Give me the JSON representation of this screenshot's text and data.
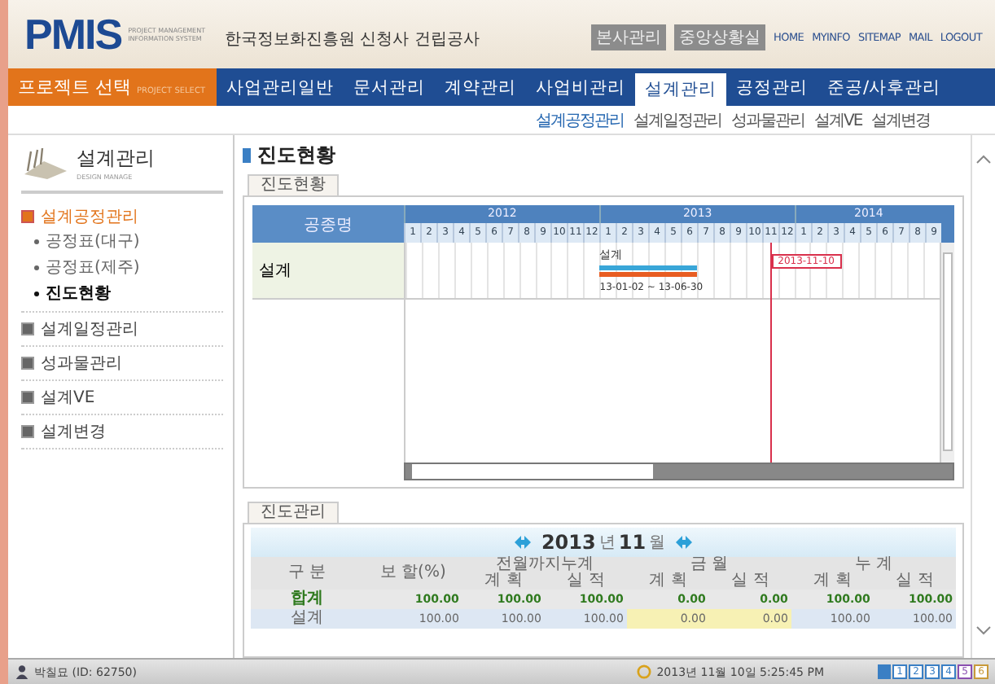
{
  "header": {
    "logo": "PMIS",
    "logo_sub": [
      "PROJECT MANAGEMENT",
      "INFORMATION SYSTEM"
    ],
    "project": "한국정보화진흥원 신청사 건립공사",
    "buttons": [
      "본사관리",
      "중앙상황실"
    ],
    "links": [
      "HOME",
      "MYINFO",
      "SITEMAP",
      "MAIL",
      "LOGOUT"
    ]
  },
  "project_select": {
    "label": "프로젝트 선택",
    "sub": "PROJECT SELECT"
  },
  "nav": [
    {
      "label": "사업관리일반",
      "selected": false
    },
    {
      "label": "문서관리",
      "selected": false
    },
    {
      "label": "계약관리",
      "selected": false
    },
    {
      "label": "사업비관리",
      "selected": false
    },
    {
      "label": "설계관리",
      "selected": true
    },
    {
      "label": "공정관리",
      "selected": false
    },
    {
      "label": "준공/사후관리",
      "selected": false
    }
  ],
  "subnav": [
    {
      "label": "설계공정관리",
      "selected": true
    },
    {
      "label": "설계일정관리",
      "selected": false
    },
    {
      "label": "성과물관리",
      "selected": false
    },
    {
      "label": "설계VE",
      "selected": false
    },
    {
      "label": "설계변경",
      "selected": false
    }
  ],
  "sidebar": {
    "title": "설계관리",
    "subtitle": "DESIGN MANAGE",
    "items": [
      {
        "label": "설계공정관리",
        "expanded": true,
        "children": [
          {
            "label": "공정표(대구)",
            "selected": false
          },
          {
            "label": "공정표(제주)",
            "selected": false
          },
          {
            "label": "진도현황",
            "selected": true
          }
        ]
      },
      {
        "label": "설계일정관리",
        "expanded": false
      },
      {
        "label": "성과물관리",
        "expanded": false
      },
      {
        "label": "설계VE",
        "expanded": false
      },
      {
        "label": "설계변경",
        "expanded": false
      }
    ]
  },
  "page_title": "진도현황",
  "gantt": {
    "tab": "진도현황",
    "name_header": "공종명",
    "years": [
      {
        "label": "2012",
        "months": [
          "1",
          "2",
          "3",
          "4",
          "5",
          "6",
          "7",
          "8",
          "9",
          "10",
          "11",
          "12"
        ]
      },
      {
        "label": "2013",
        "months": [
          "1",
          "2",
          "3",
          "4",
          "5",
          "6",
          "7",
          "8",
          "9",
          "10",
          "11",
          "12"
        ]
      },
      {
        "label": "2014",
        "months": [
          "1",
          "2",
          "3",
          "4",
          "5",
          "6",
          "7",
          "8",
          "9"
        ]
      }
    ],
    "rows": [
      {
        "name": "설계",
        "bar_label": "설계",
        "period": "13-01-02 ~ 13-06-30"
      }
    ],
    "today": {
      "label": "2013-11-10"
    }
  },
  "progress": {
    "tab": "진도관리",
    "year": "2013",
    "year_unit": "년",
    "month": "11",
    "month_unit": "월",
    "head_groups": [
      "구 분",
      "보 할(%)",
      "전월까지누계",
      "금 월",
      "누 계"
    ],
    "sub_heads": [
      "계 획",
      "실 적",
      "계 획",
      "실 적",
      "계 획",
      "실 적"
    ],
    "rows": [
      {
        "kind": "total",
        "cells": [
          "합계",
          "100.00",
          "100.00",
          "100.00",
          "0.00",
          "0.00",
          "100.00",
          "100.00"
        ]
      },
      {
        "kind": "item",
        "cells": [
          "설계",
          "100.00",
          "100.00",
          "100.00",
          "0.00",
          "0.00",
          "100.00",
          "100.00"
        ]
      }
    ]
  },
  "status_bar": {
    "user": "박칠묘 (ID: 62750)",
    "datetime": "2013년 11월 10일 5:25:45 PM",
    "pages": [
      "1",
      "2",
      "3",
      "4",
      "5",
      "6"
    ]
  }
}
